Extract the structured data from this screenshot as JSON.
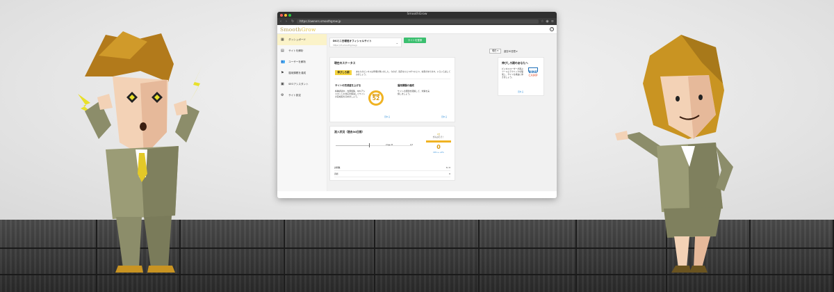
{
  "browser": {
    "window_title": "SmoothGrow",
    "url": "https://owners.smoothgrow.jp"
  },
  "app": {
    "logo_a": "Smooth",
    "logo_b": "Grow",
    "help_symbol": "?"
  },
  "sidebar": {
    "items": [
      {
        "label": "ダッシュボード",
        "icon": "dashboard-icon",
        "glyph": "▦",
        "active": true
      },
      {
        "label": "サイトを解析",
        "icon": "analytics-icon",
        "glyph": "▤"
      },
      {
        "label": "ユーザーを解析",
        "icon": "users-icon",
        "glyph": "👥"
      },
      {
        "label": "運用課題を達成",
        "icon": "flag-icon",
        "glyph": "⚑"
      },
      {
        "label": "SEOアシスタント",
        "icon": "seo-icon",
        "glyph": "▣"
      },
      {
        "label": "サイト設定",
        "icon": "settings-icon",
        "glyph": "⚙"
      }
    ]
  },
  "site": {
    "name": "DSミニ日報班オフィシャルサイト",
    "sub_url": "https://dh.smoothgrow.jp",
    "register_label": "サイトを登録"
  },
  "toolbar": {
    "filter_label": "現在 ▾",
    "period_label": "過去30日間 ▾"
  },
  "status_card": {
    "title": "現在のステータス",
    "badge": "伸びしろ期",
    "desc": "あなたのビジネスは準備が整いました。今のが、既存をひとつずつひとつ、効果があります。いろいろ試してみましょう。",
    "sub1_title": "サイトの完成度を上げる",
    "sub1_desc": "各種調査中、内部施策、SEOアシスタントの対応を解決してサイトの完成度を高めましょう。",
    "score_label": "完成度",
    "score_value": "52",
    "sub2_title": "運用課題の達成",
    "sub2_desc": "サイトの課題を把握して、対策を実施しましょう。",
    "more": "見れる"
  },
  "growth_card": {
    "title": "伸びしろ期のあなたへ",
    "desc": "ビジネスユーザーが選ぶツールとテクニックを駆使し、サイトを成長に導きましょう。",
    "bind_a": "BIND",
    "bind_b": "CAMP",
    "more": "見れる"
  },
  "traffic_card": {
    "title": "流入状況（過去30日間）",
    "slider_label_1": "21 ▶ 25",
    "slider_label_2": "0.5",
    "prize_rank": "1位",
    "prize_msg": "がんばろう！",
    "prize_points": "0",
    "prize_foot": "CPU ➜ +0%",
    "row1_left": "訪問数",
    "row1_right": "0 / 0",
    "row2_left": "直帰",
    "row2_right": "0"
  },
  "colors": {
    "accent_yellow": "#f3d23c",
    "green": "#3bbf6f",
    "link_blue": "#2a8bd8"
  }
}
